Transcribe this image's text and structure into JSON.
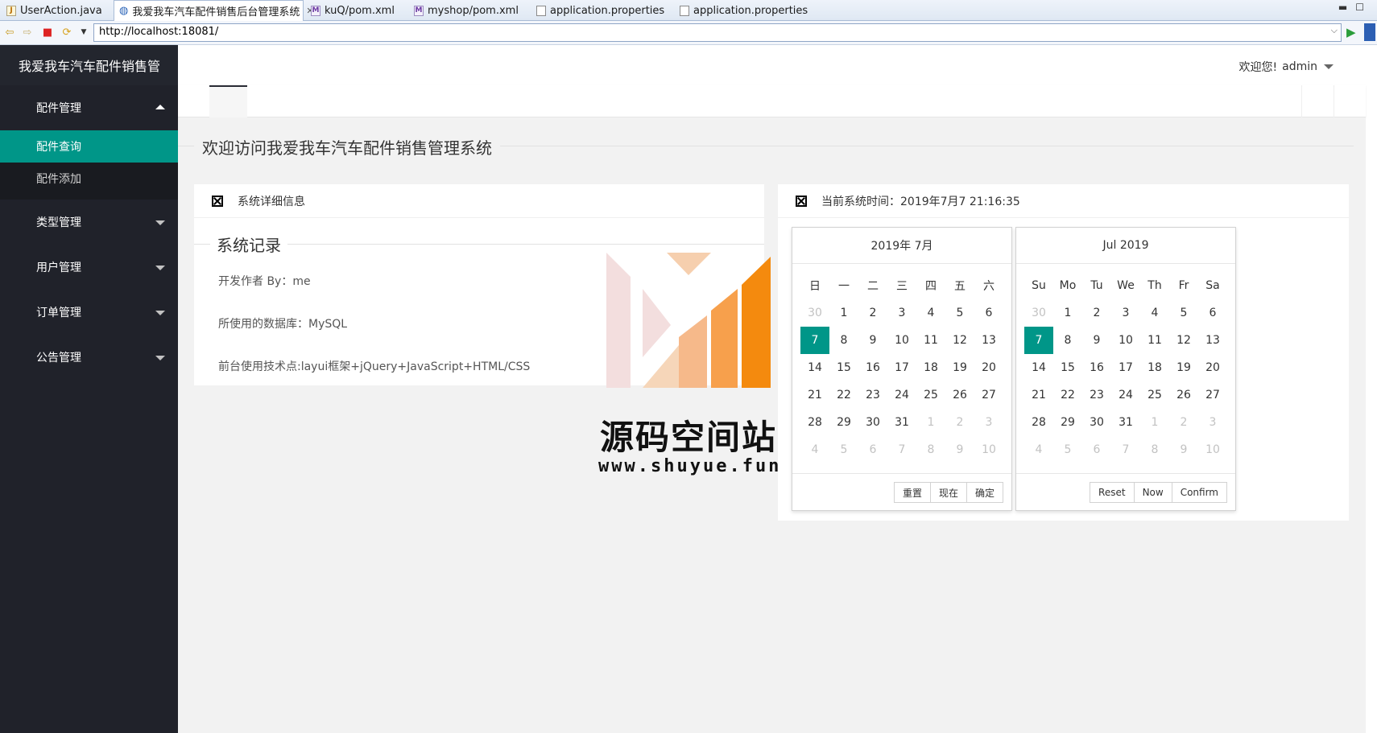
{
  "ide": {
    "tabs": [
      {
        "label": "UserAction.java",
        "icon": "java-file-icon"
      },
      {
        "label": "我爱我车汽车配件销售后台管理系统",
        "icon": "globe-icon"
      },
      {
        "label": "kuQ/pom.xml",
        "icon": "maven-xml-icon"
      },
      {
        "label": "myshop/pom.xml",
        "icon": "maven-xml-icon"
      },
      {
        "label": "application.properties",
        "icon": "properties-file-icon"
      },
      {
        "label": "application.properties",
        "icon": "properties-file-icon"
      }
    ],
    "url": "http://localhost:18081/"
  },
  "app": {
    "logo": "我爱我车汽车配件销售管",
    "menu": [
      {
        "label": "配件管理",
        "expanded": true
      },
      {
        "label": "类型管理"
      },
      {
        "label": "用户管理"
      },
      {
        "label": "订单管理"
      },
      {
        "label": "公告管理"
      }
    ],
    "submenu": [
      "配件查询",
      "配件添加"
    ],
    "user": {
      "greeting": "欢迎您!",
      "name": "admin"
    },
    "accent": "#009688",
    "sidebar_bg": "#20222a"
  },
  "main": {
    "heading": "欢迎访问我爱我车汽车配件销售管理系统",
    "info_card": {
      "title": "系统详细信息",
      "section": "系统记录",
      "lines": [
        "开发作者 By：me",
        "所使用的数据库：MySQL",
        "前台使用技术点:layui框架+jQuery+JavaScript+HTML/CSS"
      ]
    },
    "time_card": {
      "title": "当前系统时间：2019年7月7 21:16:35"
    }
  },
  "calendars": [
    {
      "header": "2019年  7月",
      "weekdays": [
        "日",
        "一",
        "二",
        "三",
        "四",
        "五",
        "六"
      ],
      "buttons": [
        "重置",
        "现在",
        "确定"
      ]
    },
    {
      "header": "Jul  2019",
      "weekdays": [
        "Su",
        "Mo",
        "Tu",
        "We",
        "Th",
        "Fr",
        "Sa"
      ],
      "buttons": [
        "Reset",
        "Now",
        "Confirm"
      ]
    }
  ],
  "month_grid": [
    [
      "30",
      "1",
      "2",
      "3",
      "4",
      "5",
      "6"
    ],
    [
      "7",
      "8",
      "9",
      "10",
      "11",
      "12",
      "13"
    ],
    [
      "14",
      "15",
      "16",
      "17",
      "18",
      "19",
      "20"
    ],
    [
      "21",
      "22",
      "23",
      "24",
      "25",
      "26",
      "27"
    ],
    [
      "28",
      "29",
      "30",
      "31",
      "1",
      "2",
      "3"
    ],
    [
      "4",
      "5",
      "6",
      "7",
      "8",
      "9",
      "10"
    ]
  ],
  "selected_day": "7",
  "watermark": {
    "title": "源码空间站",
    "url": "www.shuyue.fun"
  }
}
